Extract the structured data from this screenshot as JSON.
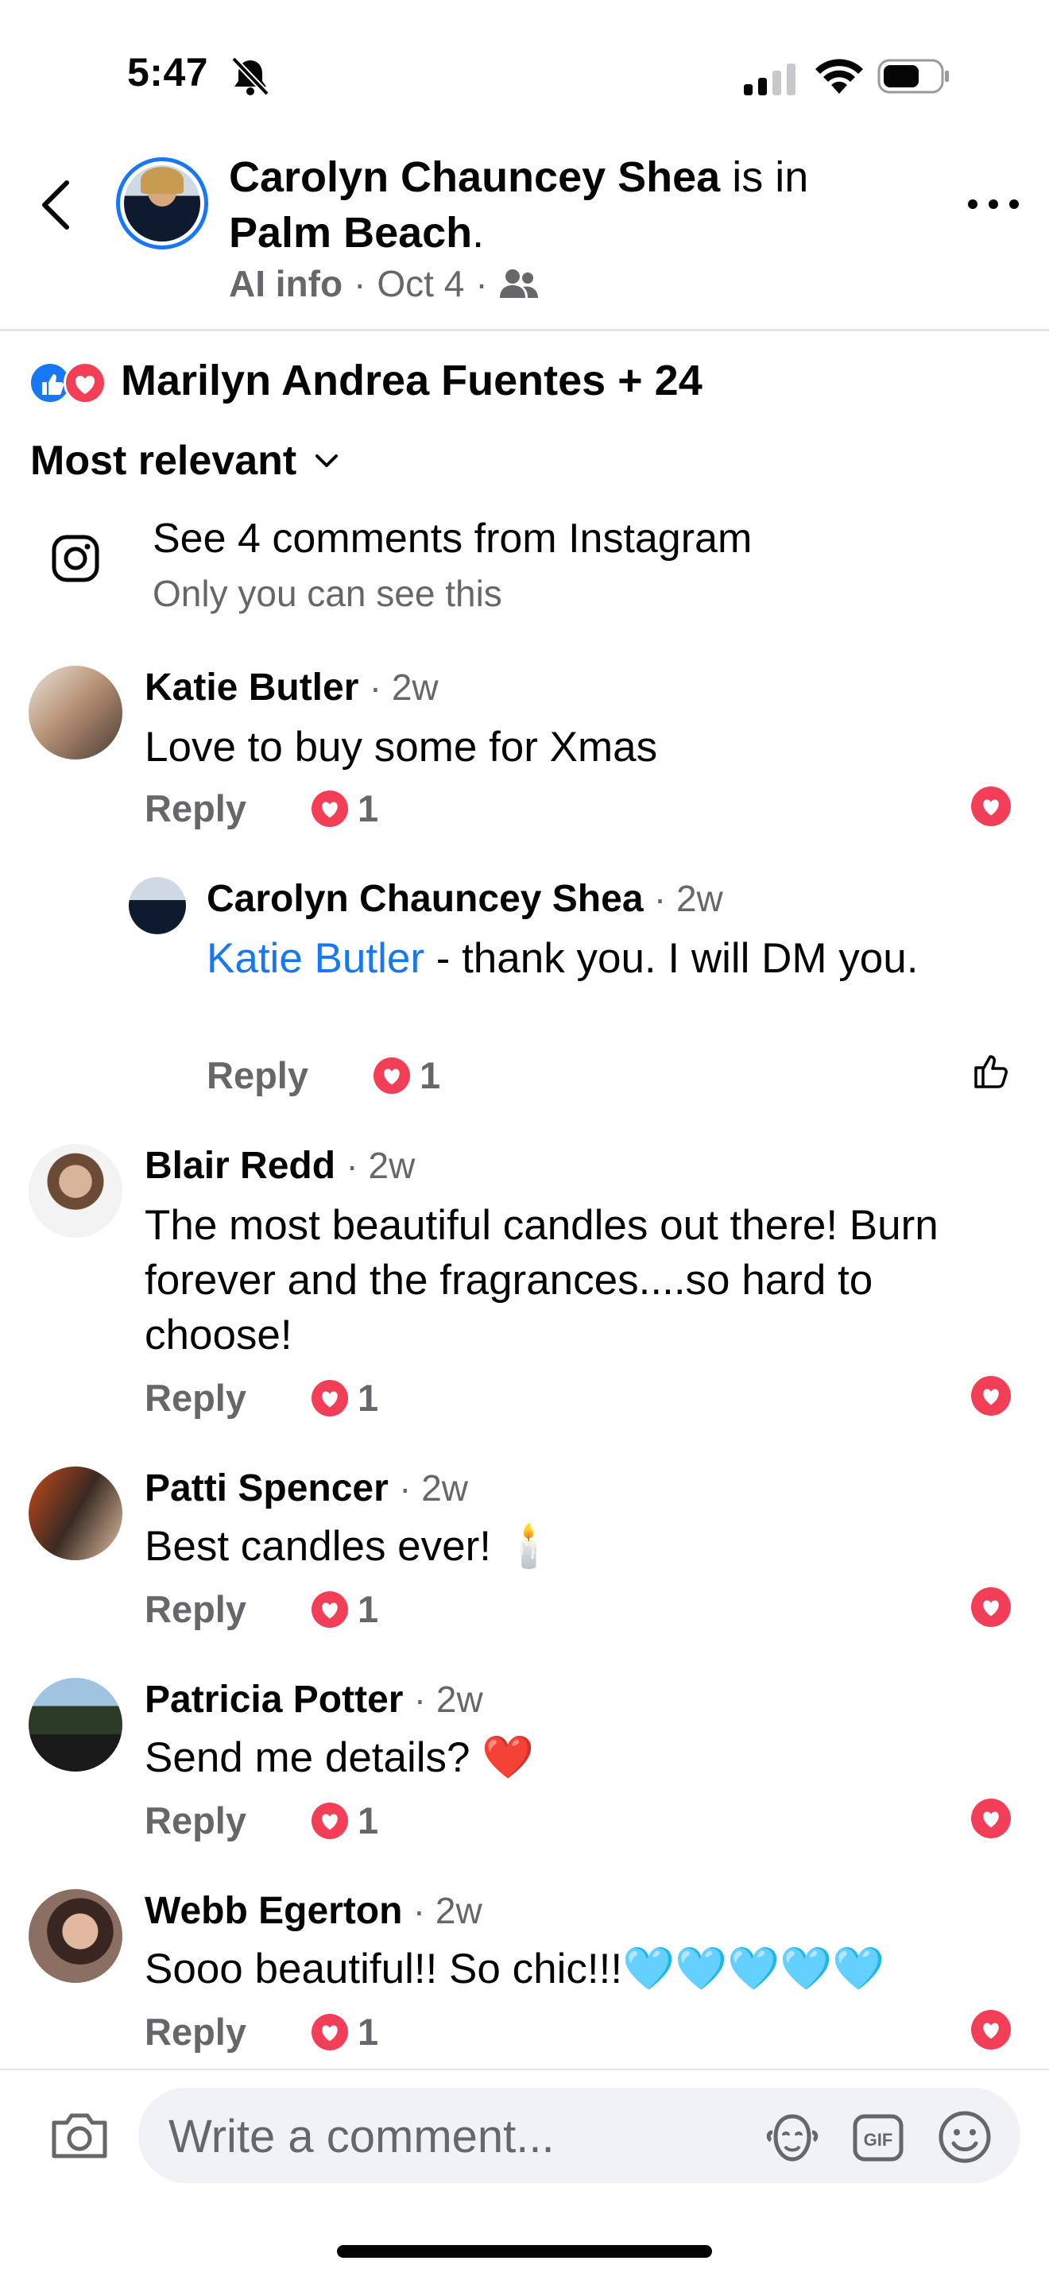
{
  "status_bar": {
    "time": "5:47",
    "icons": [
      "bell-slash-icon",
      "cellular-signal-icon",
      "wifi-icon",
      "battery-icon"
    ]
  },
  "header": {
    "author": "Carolyn Chauncey Shea",
    "title_rest_1": "is in",
    "title_place": "Palm Beach",
    "title_period": ".",
    "meta_ai": "AI info",
    "meta_sep": "·",
    "meta_date": "Oct 4",
    "audience_icon": "friends-icon"
  },
  "reactions": {
    "summary": "Marilyn Andrea Fuentes + 24",
    "types": [
      "like",
      "love"
    ]
  },
  "sort": {
    "label": "Most relevant"
  },
  "instagram": {
    "title": "See 4 comments from Instagram",
    "subtitle": "Only you can see this"
  },
  "comments": [
    {
      "name": "Katie Butler",
      "time": "· 2w",
      "text": "Love to buy some for Xmas",
      "reply": "Reply",
      "count": "1"
    },
    {
      "name": "Carolyn Chauncey Shea",
      "time": "· 2w",
      "mention": "Katie Butler",
      "text": " - thank you.  I will DM you.",
      "reply": "Reply",
      "count": "1"
    },
    {
      "name": "Blair Redd",
      "time": "· 2w",
      "text": "The most beautiful candles out there! Burn forever and the fragrances....so hard to choose!",
      "reply": "Reply",
      "count": "1"
    },
    {
      "name": "Patti Spencer",
      "time": "· 2w",
      "text": "Best candles ever! 🕯️",
      "reply": "Reply",
      "count": "1"
    },
    {
      "name": "Patricia Potter",
      "time": "· 2w",
      "text": "Send me details? ❤️",
      "reply": "Reply",
      "count": "1"
    },
    {
      "name": "Webb Egerton",
      "time": "· 2w",
      "text": "Sooo beautiful!! So chic!!!🩵🩵🩵🩵🩵",
      "reply": "Reply",
      "count": "1"
    }
  ],
  "composer": {
    "placeholder": "Write a comment...",
    "gif_label": "GIF"
  },
  "colors": {
    "accent": "#1877f2",
    "love": "#f33e58",
    "secondary_text": "#65676b"
  }
}
